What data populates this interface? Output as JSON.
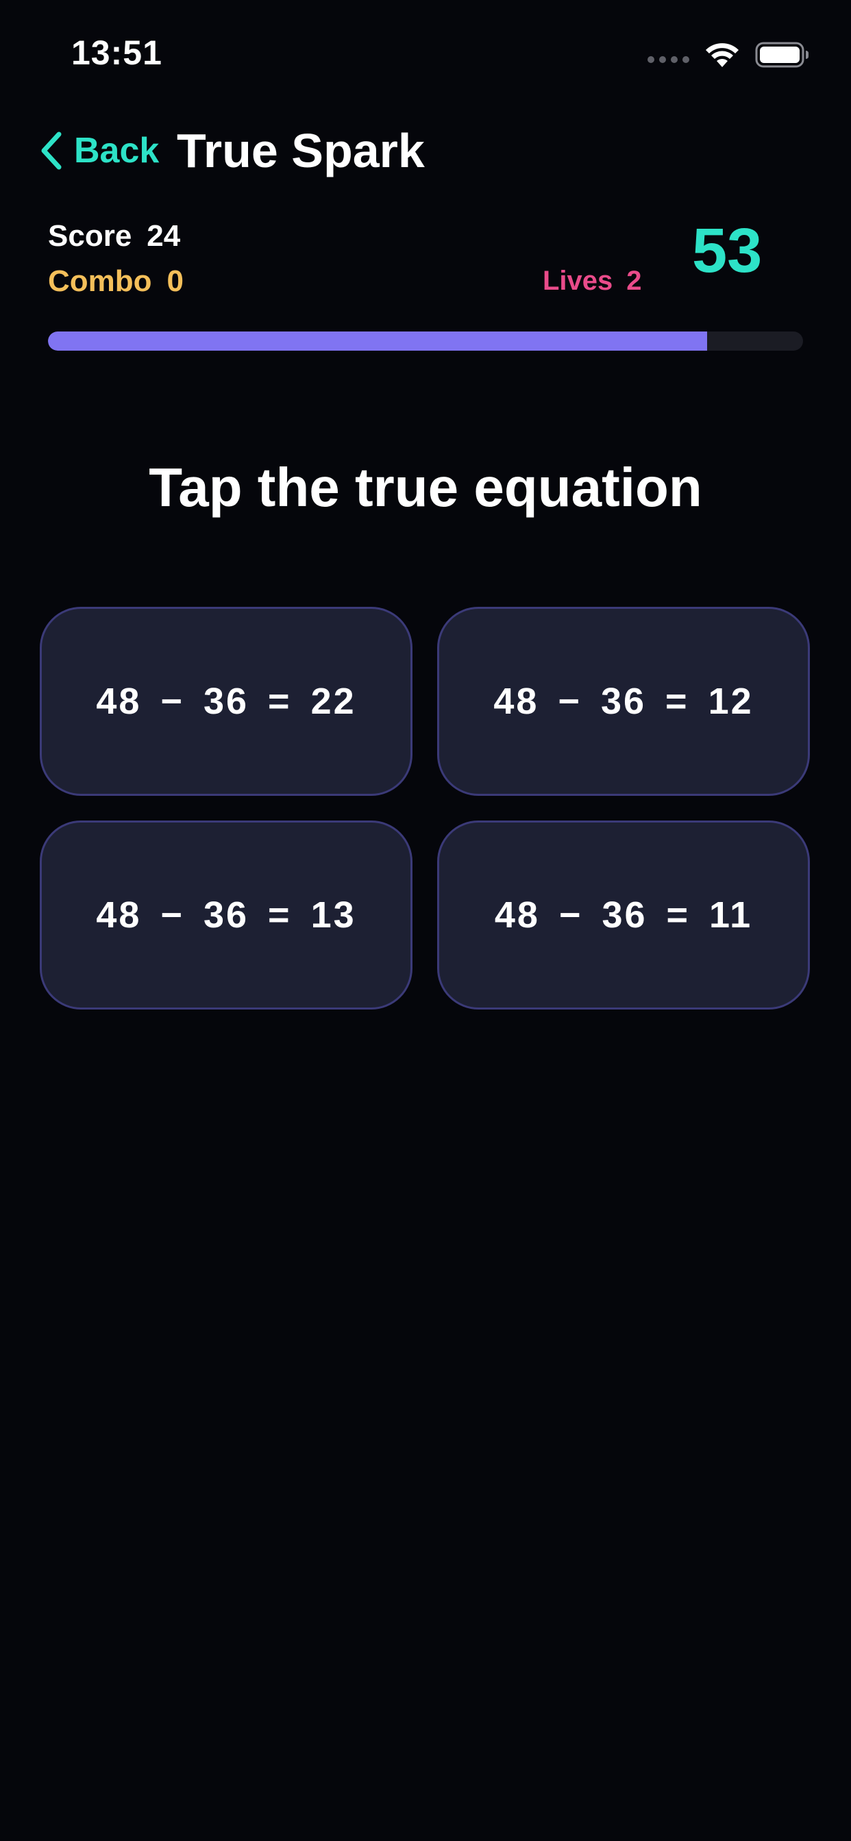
{
  "status_bar": {
    "time": "13:51"
  },
  "nav": {
    "back_label": "Back",
    "title": "True Spark"
  },
  "stats": {
    "score_label": "Score",
    "score_value": "24",
    "combo_label": "Combo",
    "combo_value": "0",
    "lives_label": "Lives",
    "lives_value": "2",
    "timer_value": "53"
  },
  "progress": {
    "fraction": 0.873
  },
  "prompt": "Tap the true equation",
  "options": [
    {
      "label": "48 − 36 = 22"
    },
    {
      "label": "48 − 36 = 12"
    },
    {
      "label": "48 − 36 = 13"
    },
    {
      "label": "48 − 36 = 11"
    }
  ],
  "colors": {
    "background": "#05060b",
    "accent_teal": "#2de2c7",
    "combo_yellow": "#f4bf5a",
    "lives_pink": "#e94b8a",
    "progress_purple": "#8074f2",
    "card_fill": "#1d2033",
    "card_border": "#3b3a78"
  },
  "icons": {
    "back": "chevron-left-icon",
    "wifi": "wifi-icon",
    "battery": "battery-icon",
    "signal": "cellular-signal-icon"
  }
}
